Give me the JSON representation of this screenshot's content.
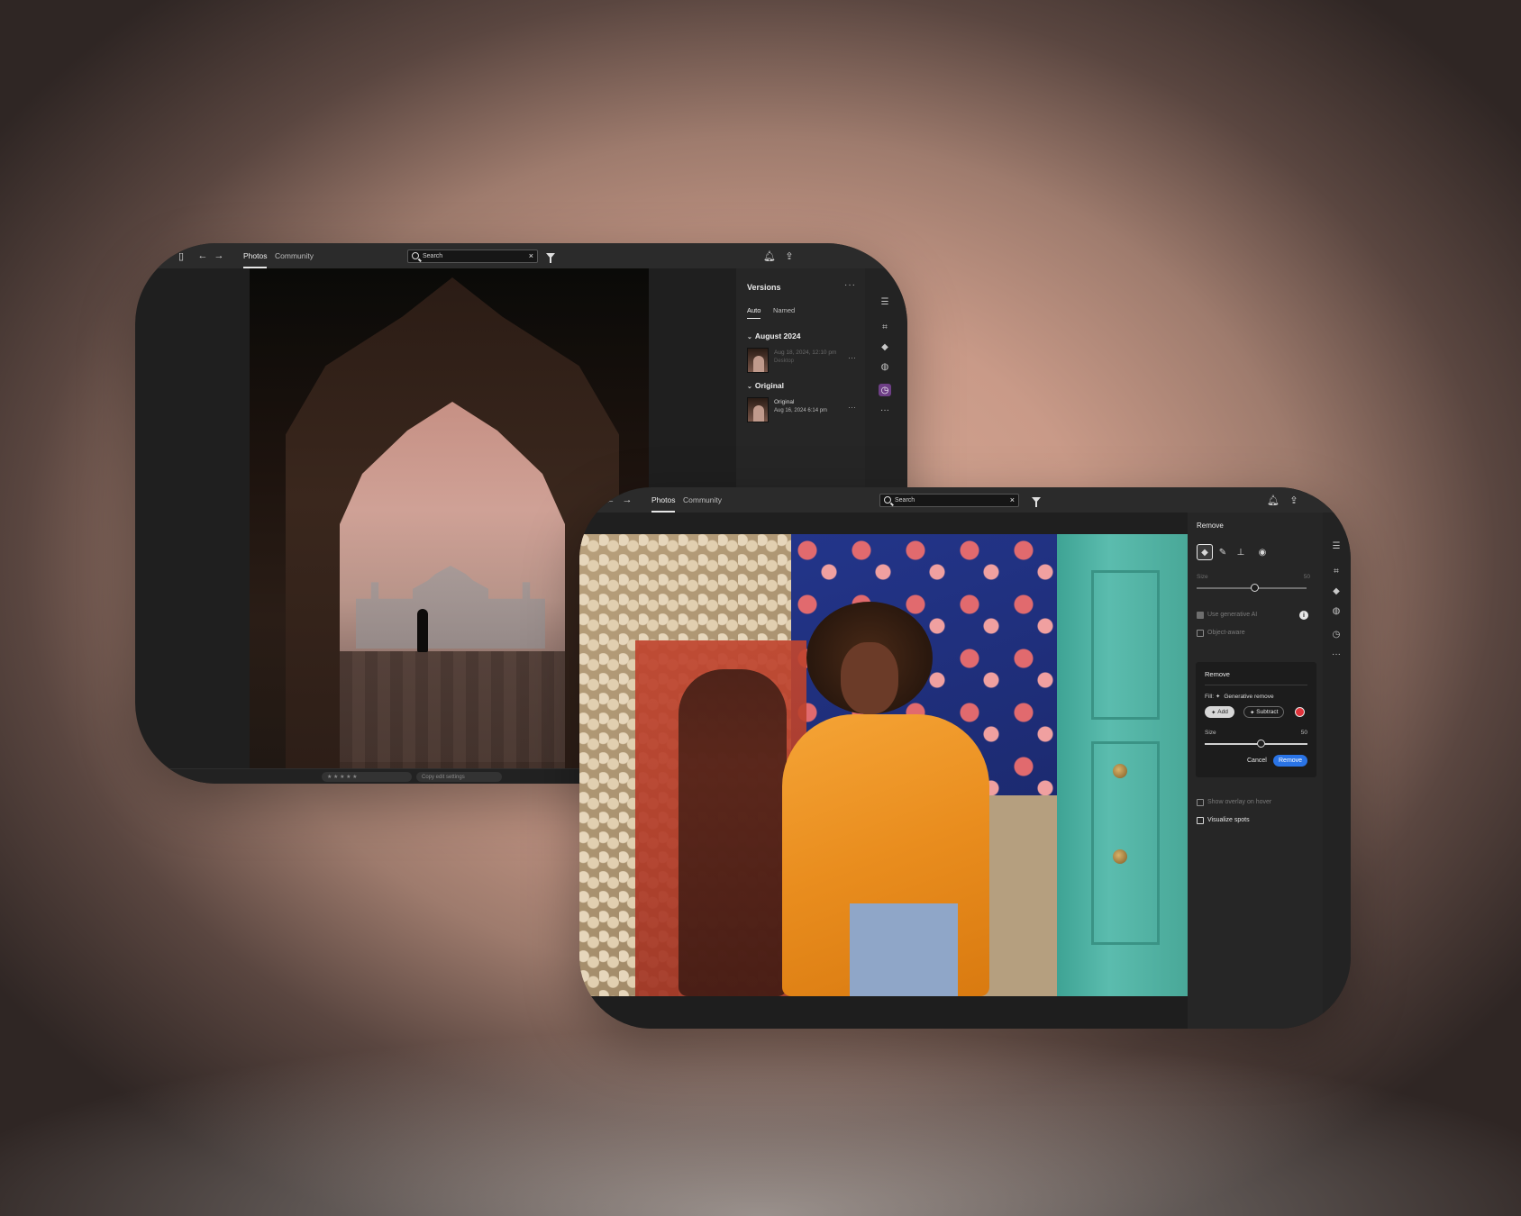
{
  "window_back": {
    "tabs": [
      "Photos",
      "Community"
    ],
    "search": {
      "placeholder": "Search"
    },
    "panel": {
      "title": "Versions",
      "tabs": [
        "Auto",
        "Named"
      ],
      "groups": [
        {
          "label": "August 2024",
          "items": [
            {
              "name": "Aug 18, 2024, 12:10 pm",
              "sub": "Desktop"
            }
          ]
        },
        {
          "label": "Original",
          "items": [
            {
              "name": "Original",
              "sub": "Aug 16, 2024 6:14 pm"
            }
          ]
        }
      ]
    },
    "bottom": {
      "copy_edit": "Copy edit settings"
    }
  },
  "window_front": {
    "tabs": [
      "Photos",
      "Community"
    ],
    "search": {
      "placeholder": "Search"
    },
    "panel": {
      "title": "Remove",
      "size_label": "Size",
      "size_value": "50",
      "use_gen_ai": "Use generative AI",
      "object_aware": "Object-aware",
      "card": {
        "title": "Remove",
        "fill_label": "Fill:",
        "fill_value": "Generative remove",
        "add": "Add",
        "subtract": "Subtract",
        "size_label": "Size",
        "size_value": "50",
        "cancel": "Cancel",
        "remove": "Remove"
      },
      "show_overlay": "Show overlay on hover",
      "visualize_spots": "Visualize spots"
    }
  },
  "icons": {
    "back": "left-arrow-icon",
    "forward": "right-arrow-icon",
    "panel": "panel-toggle-icon",
    "bell": "bell-icon",
    "share": "share-icon",
    "filter": "filter-icon"
  }
}
